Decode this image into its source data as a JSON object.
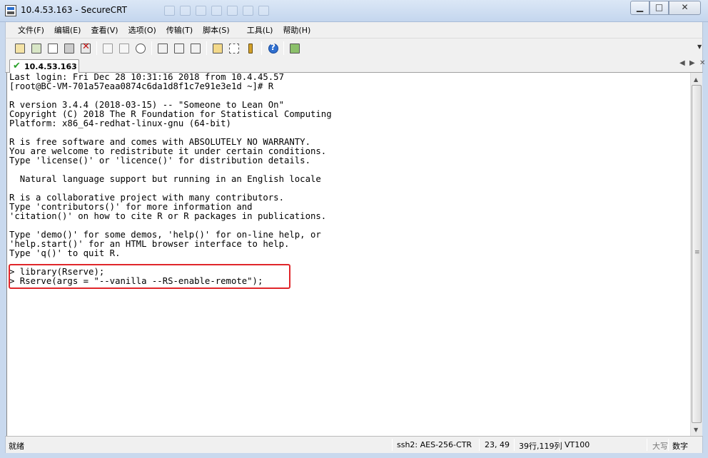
{
  "window": {
    "title": "10.4.53.163 - SecureCRT"
  },
  "menu": [
    "文件(F)",
    "编辑(E)",
    "查看(V)",
    "选项(O)",
    "传输(T)",
    "脚本(S)",
    "工具(L)",
    "帮助(H)"
  ],
  "toolbar_icons": [
    "connect-icon",
    "quick-connect-icon",
    "connect-in-tab-icon",
    "reconnect-icon",
    "disconnect-icon",
    "copy-icon",
    "paste-icon",
    "find-icon",
    "print-icon",
    "print-selection-icon",
    "print-setup-icon",
    "session-options-icon",
    "keymap-icon",
    "key-icon",
    "help-icon",
    "map-icon"
  ],
  "session_tab": {
    "label": "10.4.53.163",
    "status_icon": "check-icon"
  },
  "terminal": {
    "lines": [
      "Last login: Fri Dec 28 10:31:16 2018 from 10.4.45.57",
      "[root@BC-VM-701a57eaa0874c6da1d8f1c7e91e3e1d ~]# R",
      "",
      "R version 3.4.4 (2018-03-15) -- \"Someone to Lean On\"",
      "Copyright (C) 2018 The R Foundation for Statistical Computing",
      "Platform: x86_64-redhat-linux-gnu (64-bit)",
      "",
      "R is free software and comes with ABSOLUTELY NO WARRANTY.",
      "You are welcome to redistribute it under certain conditions.",
      "Type 'license()' or 'licence()' for distribution details.",
      "",
      "  Natural language support but running in an English locale",
      "",
      "R is a collaborative project with many contributors.",
      "Type 'contributors()' for more information and",
      "'citation()' on how to cite R or R packages in publications.",
      "",
      "Type 'demo()' for some demos, 'help()' for on-line help, or",
      "'help.start()' for an HTML browser interface to help.",
      "Type 'q()' to quit R.",
      "",
      "> library(Rserve);",
      "> Rserve(args = \"--vanilla --RS-enable-remote\");"
    ],
    "highlight_color": "#e0262a"
  },
  "status": {
    "ready": "就绪",
    "protocol": "ssh2: AES-256-CTR",
    "cursor": "23, 49",
    "size": "39行,119列",
    "emulation": "VT100",
    "caps": "大写",
    "num": "数字"
  }
}
